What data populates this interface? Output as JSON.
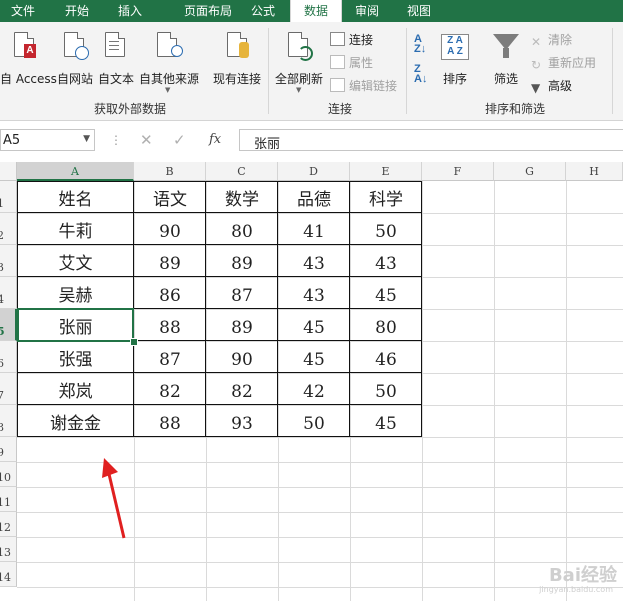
{
  "ribbon": {
    "tabs": [
      "文件",
      "开始",
      "插入",
      "页面布局",
      "公式",
      "数据",
      "审阅",
      "视图"
    ],
    "active_tab": "数据",
    "buttons": {
      "access": "自 Access",
      "web": "自网站",
      "text": "自文本",
      "other": "自其他来源",
      "existing": "现有连接",
      "refresh_all": "全部刷新",
      "sort": "排序",
      "filter": "筛选"
    },
    "small": {
      "connections": "连接",
      "properties": "属性",
      "edit_links": "编辑链接",
      "clear": "清除",
      "reapply": "重新应用",
      "advanced": "高级"
    },
    "groups": {
      "external": "获取外部数据",
      "connections": "连接",
      "sort_filter": "排序和筛选"
    }
  },
  "formula_bar": {
    "name_box": "A5",
    "fx": "fx",
    "value": "张丽"
  },
  "grid": {
    "columns": [
      "A",
      "B",
      "C",
      "D",
      "E",
      "F",
      "G",
      "H"
    ],
    "rows": [
      "1",
      "2",
      "3",
      "4",
      "5",
      "6",
      "7",
      "8",
      "9",
      "10",
      "11",
      "12",
      "13",
      "14"
    ],
    "selected_cell": "A5",
    "table": {
      "header": [
        "姓名",
        "语文",
        "数学",
        "品德",
        "科学"
      ],
      "rows": [
        [
          "牛莉",
          "90",
          "80",
          "41",
          "50"
        ],
        [
          "艾文",
          "89",
          "89",
          "43",
          "43"
        ],
        [
          "吴赫",
          "86",
          "87",
          "43",
          "45"
        ],
        [
          "张丽",
          "88",
          "89",
          "45",
          "80"
        ],
        [
          "张强",
          "87",
          "90",
          "45",
          "46"
        ],
        [
          "郑岚",
          "82",
          "82",
          "42",
          "50"
        ],
        [
          "谢金金",
          "88",
          "93",
          "50",
          "45"
        ]
      ]
    }
  },
  "colors": {
    "excel_green": "#217346",
    "arrow_red": "#e02020",
    "access_red": "#c4262e",
    "ribbon_blue": "#2b6cb0"
  },
  "watermark": {
    "brand": "Bai经验",
    "url": "jingyan.baidu.com"
  }
}
